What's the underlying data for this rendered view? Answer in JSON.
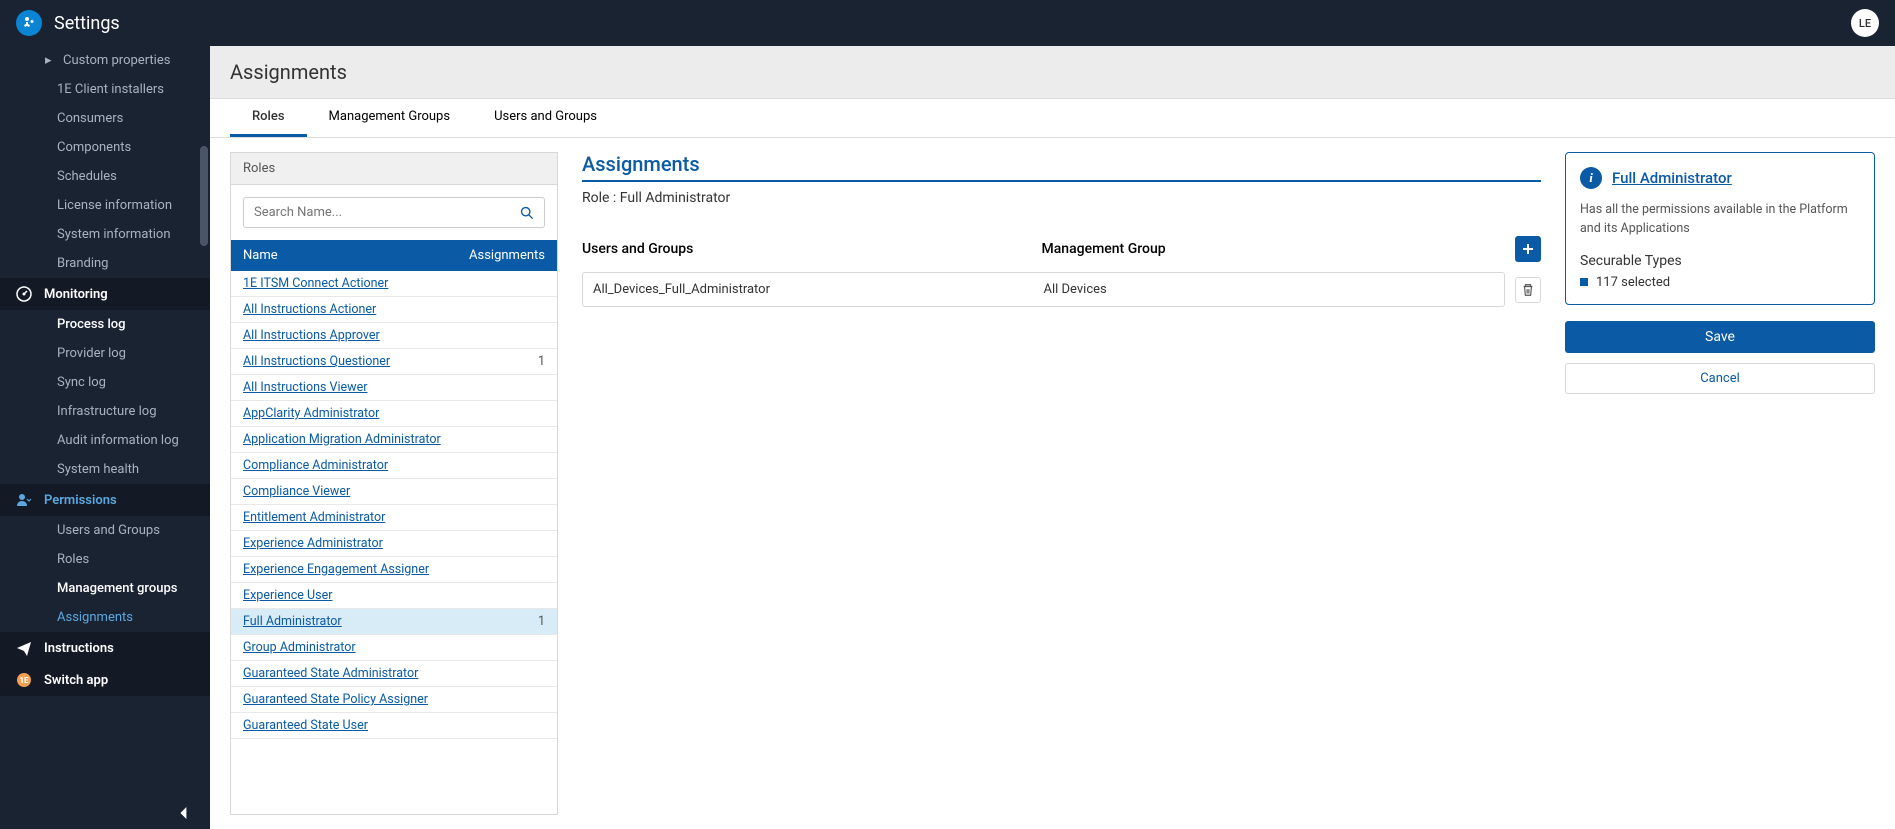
{
  "app": {
    "title": "Settings",
    "user_initials": "LE"
  },
  "sidebar": {
    "items": [
      {
        "label": "Custom properties",
        "type": "item",
        "arrow": true
      },
      {
        "label": "1E Client installers",
        "type": "item"
      },
      {
        "label": "Consumers",
        "type": "item"
      },
      {
        "label": "Components",
        "type": "item"
      },
      {
        "label": "Schedules",
        "type": "item"
      },
      {
        "label": "License information",
        "type": "item"
      },
      {
        "label": "System information",
        "type": "item"
      },
      {
        "label": "Branding",
        "type": "item"
      },
      {
        "label": "Monitoring",
        "type": "header",
        "icon": "gauge"
      },
      {
        "label": "Process log",
        "type": "item",
        "bold": true
      },
      {
        "label": "Provider log",
        "type": "item"
      },
      {
        "label": "Sync log",
        "type": "item"
      },
      {
        "label": "Infrastructure log",
        "type": "item"
      },
      {
        "label": "Audit information log",
        "type": "item"
      },
      {
        "label": "System health",
        "type": "item"
      },
      {
        "label": "Permissions",
        "type": "header",
        "icon": "user",
        "active": true
      },
      {
        "label": "Users and Groups",
        "type": "item"
      },
      {
        "label": "Roles",
        "type": "item"
      },
      {
        "label": "Management groups",
        "type": "item",
        "bold": true
      },
      {
        "label": "Assignments",
        "type": "item",
        "active": true
      },
      {
        "label": "Instructions",
        "type": "header",
        "icon": "plane"
      },
      {
        "label": "Switch app",
        "type": "header",
        "icon": "switch"
      }
    ]
  },
  "page": {
    "title": "Assignments",
    "tabs": [
      "Roles",
      "Management Groups",
      "Users and Groups"
    ],
    "active_tab": 0
  },
  "roles_panel": {
    "title": "Roles",
    "search_placeholder": "Search Name...",
    "columns": {
      "name": "Name",
      "assignments": "Assignments"
    },
    "rows": [
      {
        "name": "1E ITSM Connect Actioner",
        "count": ""
      },
      {
        "name": "All Instructions Actioner",
        "count": ""
      },
      {
        "name": "All Instructions Approver",
        "count": ""
      },
      {
        "name": "All Instructions Questioner",
        "count": "1"
      },
      {
        "name": "All Instructions Viewer",
        "count": ""
      },
      {
        "name": "AppClarity Administrator",
        "count": ""
      },
      {
        "name": "Application Migration Administrator",
        "count": ""
      },
      {
        "name": "Compliance Administrator",
        "count": ""
      },
      {
        "name": "Compliance Viewer",
        "count": ""
      },
      {
        "name": "Entitlement Administrator",
        "count": ""
      },
      {
        "name": "Experience Administrator",
        "count": ""
      },
      {
        "name": "Experience Engagement Assigner",
        "count": ""
      },
      {
        "name": "Experience User",
        "count": ""
      },
      {
        "name": "Full Administrator",
        "count": "1",
        "selected": true
      },
      {
        "name": "Group Administrator",
        "count": ""
      },
      {
        "name": "Guaranteed State Administrator",
        "count": ""
      },
      {
        "name": "Guaranteed State Policy Assigner",
        "count": ""
      },
      {
        "name": "Guaranteed State User",
        "count": ""
      }
    ]
  },
  "detail": {
    "title": "Assignments",
    "subtitle": "Role : Full Administrator",
    "columns": {
      "users": "Users and Groups",
      "mg": "Management Group"
    },
    "rows": [
      {
        "user": "All_Devices_Full_Administrator",
        "mg": "All Devices"
      }
    ]
  },
  "info": {
    "title": "Full Administrator",
    "description": "Has all the permissions available in the Platform and its Applications",
    "sec_title": "Securable Types",
    "sec_count": "117 selected",
    "save_label": "Save",
    "cancel_label": "Cancel"
  }
}
